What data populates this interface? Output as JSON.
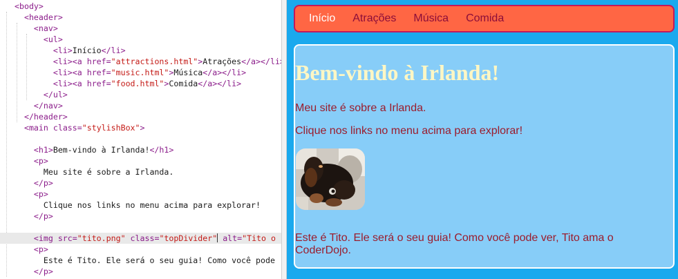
{
  "editor": {
    "lines": [
      [
        {
          "t": "tag",
          "v": "<body>"
        }
      ],
      [
        {
          "t": "txt",
          "v": "  "
        },
        {
          "t": "tag",
          "v": "<header>"
        }
      ],
      [
        {
          "t": "txt",
          "v": "    "
        },
        {
          "t": "tag",
          "v": "<nav>"
        }
      ],
      [
        {
          "t": "txt",
          "v": "      "
        },
        {
          "t": "tag",
          "v": "<ul>"
        }
      ],
      [
        {
          "t": "txt",
          "v": "        "
        },
        {
          "t": "tag",
          "v": "<li>"
        },
        {
          "t": "txt",
          "v": "Início"
        },
        {
          "t": "tag",
          "v": "</li>"
        }
      ],
      [
        {
          "t": "txt",
          "v": "        "
        },
        {
          "t": "tag",
          "v": "<li><a "
        },
        {
          "t": "attr",
          "v": "href="
        },
        {
          "t": "str",
          "v": "\"attractions.html\""
        },
        {
          "t": "tag",
          "v": ">"
        },
        {
          "t": "txt",
          "v": "Atrações"
        },
        {
          "t": "tag",
          "v": "</a></li>"
        }
      ],
      [
        {
          "t": "txt",
          "v": "        "
        },
        {
          "t": "tag",
          "v": "<li><a "
        },
        {
          "t": "attr",
          "v": "href="
        },
        {
          "t": "str",
          "v": "\"music.html\""
        },
        {
          "t": "tag",
          "v": ">"
        },
        {
          "t": "txt",
          "v": "Música"
        },
        {
          "t": "tag",
          "v": "</a></li>"
        }
      ],
      [
        {
          "t": "txt",
          "v": "        "
        },
        {
          "t": "tag",
          "v": "<li><a "
        },
        {
          "t": "attr",
          "v": "href="
        },
        {
          "t": "str",
          "v": "\"food.html\""
        },
        {
          "t": "tag",
          "v": ">"
        },
        {
          "t": "txt",
          "v": "Comida"
        },
        {
          "t": "tag",
          "v": "</a></li>"
        }
      ],
      [
        {
          "t": "txt",
          "v": "      "
        },
        {
          "t": "tag",
          "v": "</ul>"
        }
      ],
      [
        {
          "t": "txt",
          "v": "    "
        },
        {
          "t": "tag",
          "v": "</nav>"
        }
      ],
      [
        {
          "t": "txt",
          "v": "  "
        },
        {
          "t": "tag",
          "v": "</header>"
        }
      ],
      [
        {
          "t": "txt",
          "v": "  "
        },
        {
          "t": "tag",
          "v": "<main "
        },
        {
          "t": "attr",
          "v": "class="
        },
        {
          "t": "str",
          "v": "\"stylishBox\""
        },
        {
          "t": "tag",
          "v": ">"
        }
      ],
      [],
      [
        {
          "t": "txt",
          "v": "    "
        },
        {
          "t": "tag",
          "v": "<h1>"
        },
        {
          "t": "txt",
          "v": "Bem-vindo à Irlanda!"
        },
        {
          "t": "tag",
          "v": "</h1>"
        }
      ],
      [
        {
          "t": "txt",
          "v": "    "
        },
        {
          "t": "tag",
          "v": "<p>"
        }
      ],
      [
        {
          "t": "txt",
          "v": "      Meu site é sobre a Irlanda."
        }
      ],
      [
        {
          "t": "txt",
          "v": "    "
        },
        {
          "t": "tag",
          "v": "</p>"
        }
      ],
      [
        {
          "t": "txt",
          "v": "    "
        },
        {
          "t": "tag",
          "v": "<p>"
        }
      ],
      [
        {
          "t": "txt",
          "v": "      Clique nos links no menu acima para explorar!"
        }
      ],
      [
        {
          "t": "txt",
          "v": "    "
        },
        {
          "t": "tag",
          "v": "</p>"
        }
      ],
      [],
      [
        {
          "t": "txt",
          "v": "    "
        },
        {
          "t": "tag",
          "v": "<img "
        },
        {
          "t": "attr",
          "v": "src="
        },
        {
          "t": "str",
          "v": "\"tito.png\""
        },
        {
          "t": "txt",
          "v": " "
        },
        {
          "t": "attr",
          "v": "class="
        },
        {
          "t": "str",
          "v": "\"topDivider\""
        },
        {
          "t": "cursor",
          "v": ""
        },
        {
          "t": "txt",
          "v": " "
        },
        {
          "t": "attr",
          "v": "alt="
        },
        {
          "t": "str",
          "v": "\"Tito o"
        }
      ],
      [
        {
          "t": "txt",
          "v": "    "
        },
        {
          "t": "tag",
          "v": "<p>"
        }
      ],
      [
        {
          "t": "txt",
          "v": "      Este é Tito. Ele será o seu guia! Como você pode"
        }
      ],
      [
        {
          "t": "txt",
          "v": "    "
        },
        {
          "t": "tag",
          "v": "</p>"
        }
      ]
    ],
    "active_line": 21
  },
  "preview": {
    "nav": [
      "Início",
      "Atrações",
      "Música",
      "Comida"
    ],
    "heading": "Bem-vindo à Irlanda!",
    "p1": "Meu site é sobre a Irlanda.",
    "p2": "Clique nos links no menu acima para explorar!",
    "p3": "Este é Tito. Ele será o seu guia! Como você pode ver, Tito ama o CoderDojo.",
    "image_alt": "Tito o",
    "colors": {
      "page_bg": "#1aa9ee",
      "nav_bg": "#ff6644",
      "nav_border": "#c2185b",
      "nav_active_text": "#ffffff",
      "nav_text": "#8b0e3a",
      "box_bg": "#87cdf8",
      "heading": "#fff7c4",
      "paragraph": "#9b1c2c"
    }
  }
}
